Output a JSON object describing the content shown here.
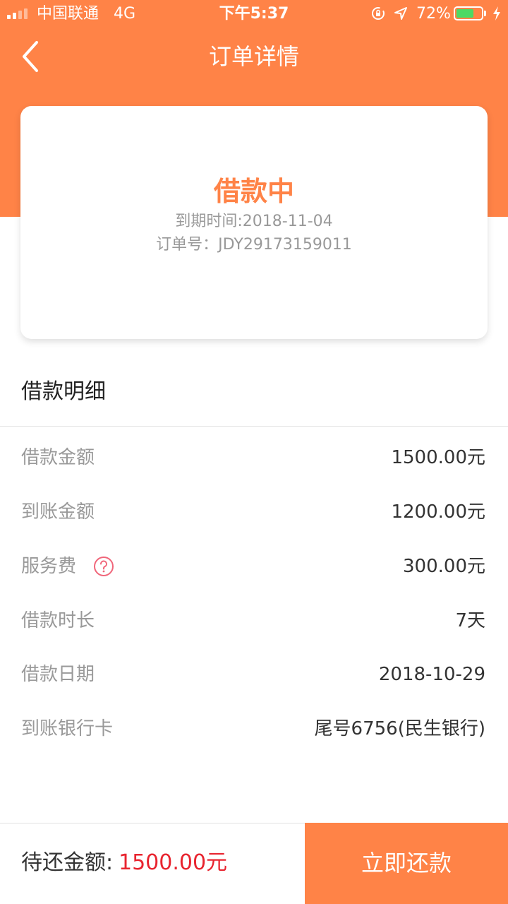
{
  "status_bar": {
    "carrier": "中国联通",
    "network": "4G",
    "time": "下午5:37",
    "battery_percent": "72%",
    "battery_level": 0.72,
    "icons": [
      "signal-icon",
      "rotation-lock-icon",
      "location-icon",
      "battery-icon",
      "charging-icon"
    ]
  },
  "nav": {
    "back_icon": "chevron-left-icon",
    "title": "订单详情"
  },
  "status_card": {
    "state": "借款中",
    "due_date": "到期时间:2018-11-04",
    "order_no": "订单号：JDY29173159011"
  },
  "details": {
    "title": "借款明细",
    "rows": [
      {
        "label": "借款金额",
        "value": "1500.00元"
      },
      {
        "label": "到账金额",
        "value": "1200.00元"
      },
      {
        "label": "服务费",
        "value": "300.00元",
        "icon": "question-circle-icon"
      },
      {
        "label": "借款时长",
        "value": "7天"
      },
      {
        "label": "借款日期",
        "value": "2018-10-29"
      },
      {
        "label": "到账银行卡",
        "value": "尾号6756(民生银行)"
      }
    ]
  },
  "footer": {
    "due_label": "待还金额:",
    "due_amount": "1500.00元",
    "pay_button": "立即还款"
  },
  "colors": {
    "accent": "#ff8347",
    "amount_red": "#e8242f",
    "help_icon": "#f0667a",
    "battery_green": "#4cd964"
  }
}
